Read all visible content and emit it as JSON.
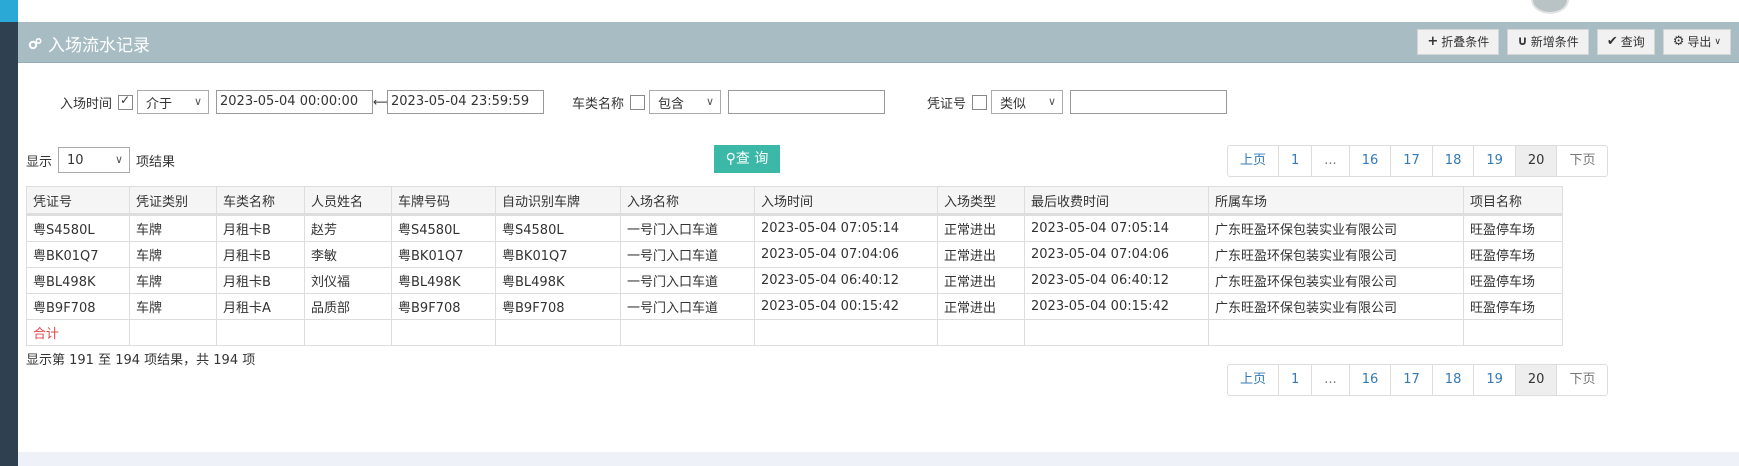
{
  "header": {
    "title": "入场流水记录",
    "buttons": [
      "折叠条件",
      "新增条件",
      "查询",
      "导出"
    ]
  },
  "filters": {
    "time_label": "入场时间",
    "time_operator": "介于",
    "time_start": "2023-05-04 00:00:00",
    "time_end": "2023-05-04 23:59:59",
    "cartype_label": "车类名称",
    "cartype_operator": "包含",
    "cartype_value": "",
    "voucher_label": "凭证号",
    "voucher_operator": "类似",
    "voucher_value": ""
  },
  "query_button": "查 询",
  "page_size": {
    "prefix": "显示",
    "value": "10",
    "suffix": "项结果"
  },
  "pager": [
    "上页",
    "1",
    "...",
    "16",
    "17",
    "18",
    "19",
    "20",
    "下页"
  ],
  "pager_active": "20",
  "table": {
    "headers": [
      "凭证号",
      "凭证类别",
      "车类名称",
      "人员姓名",
      "车牌号码",
      "自动识别车牌",
      "入场名称",
      "入场时间",
      "入场类型",
      "最后收费时间",
      "所属车场",
      "项目名称"
    ],
    "rows": [
      [
        "粤S4580L",
        "车牌",
        "月租卡B",
        "赵芳",
        "粤S4580L",
        "粤S4580L",
        "一号门入口车道",
        "2023-05-04 07:05:14",
        "正常进出",
        "2023-05-04 07:05:14",
        "广东旺盈环保包装实业有限公司",
        "旺盈停车场"
      ],
      [
        "粤BK01Q7",
        "车牌",
        "月租卡B",
        "李敏",
        "粤BK01Q7",
        "粤BK01Q7",
        "一号门入口车道",
        "2023-05-04 07:04:06",
        "正常进出",
        "2023-05-04 07:04:06",
        "广东旺盈环保包装实业有限公司",
        "旺盈停车场"
      ],
      [
        "粤BL498K",
        "车牌",
        "月租卡B",
        "刘仪福",
        "粤BL498K",
        "粤BL498K",
        "一号门入口车道",
        "2023-05-04 06:40:12",
        "正常进出",
        "2023-05-04 06:40:12",
        "广东旺盈环保包装实业有限公司",
        "旺盈停车场"
      ],
      [
        "粤B9F708",
        "车牌",
        "月租卡A",
        "品质部",
        "粤B9F708",
        "粤B9F708",
        "一号门入口车道",
        "2023-05-04 00:15:42",
        "正常进出",
        "2023-05-04 00:15:42",
        "广东旺盈环保包装实业有限公司",
        "旺盈停车场"
      ]
    ],
    "total_label": "合计"
  },
  "summary": "显示第 191 至 194 项结果，共 194 项"
}
